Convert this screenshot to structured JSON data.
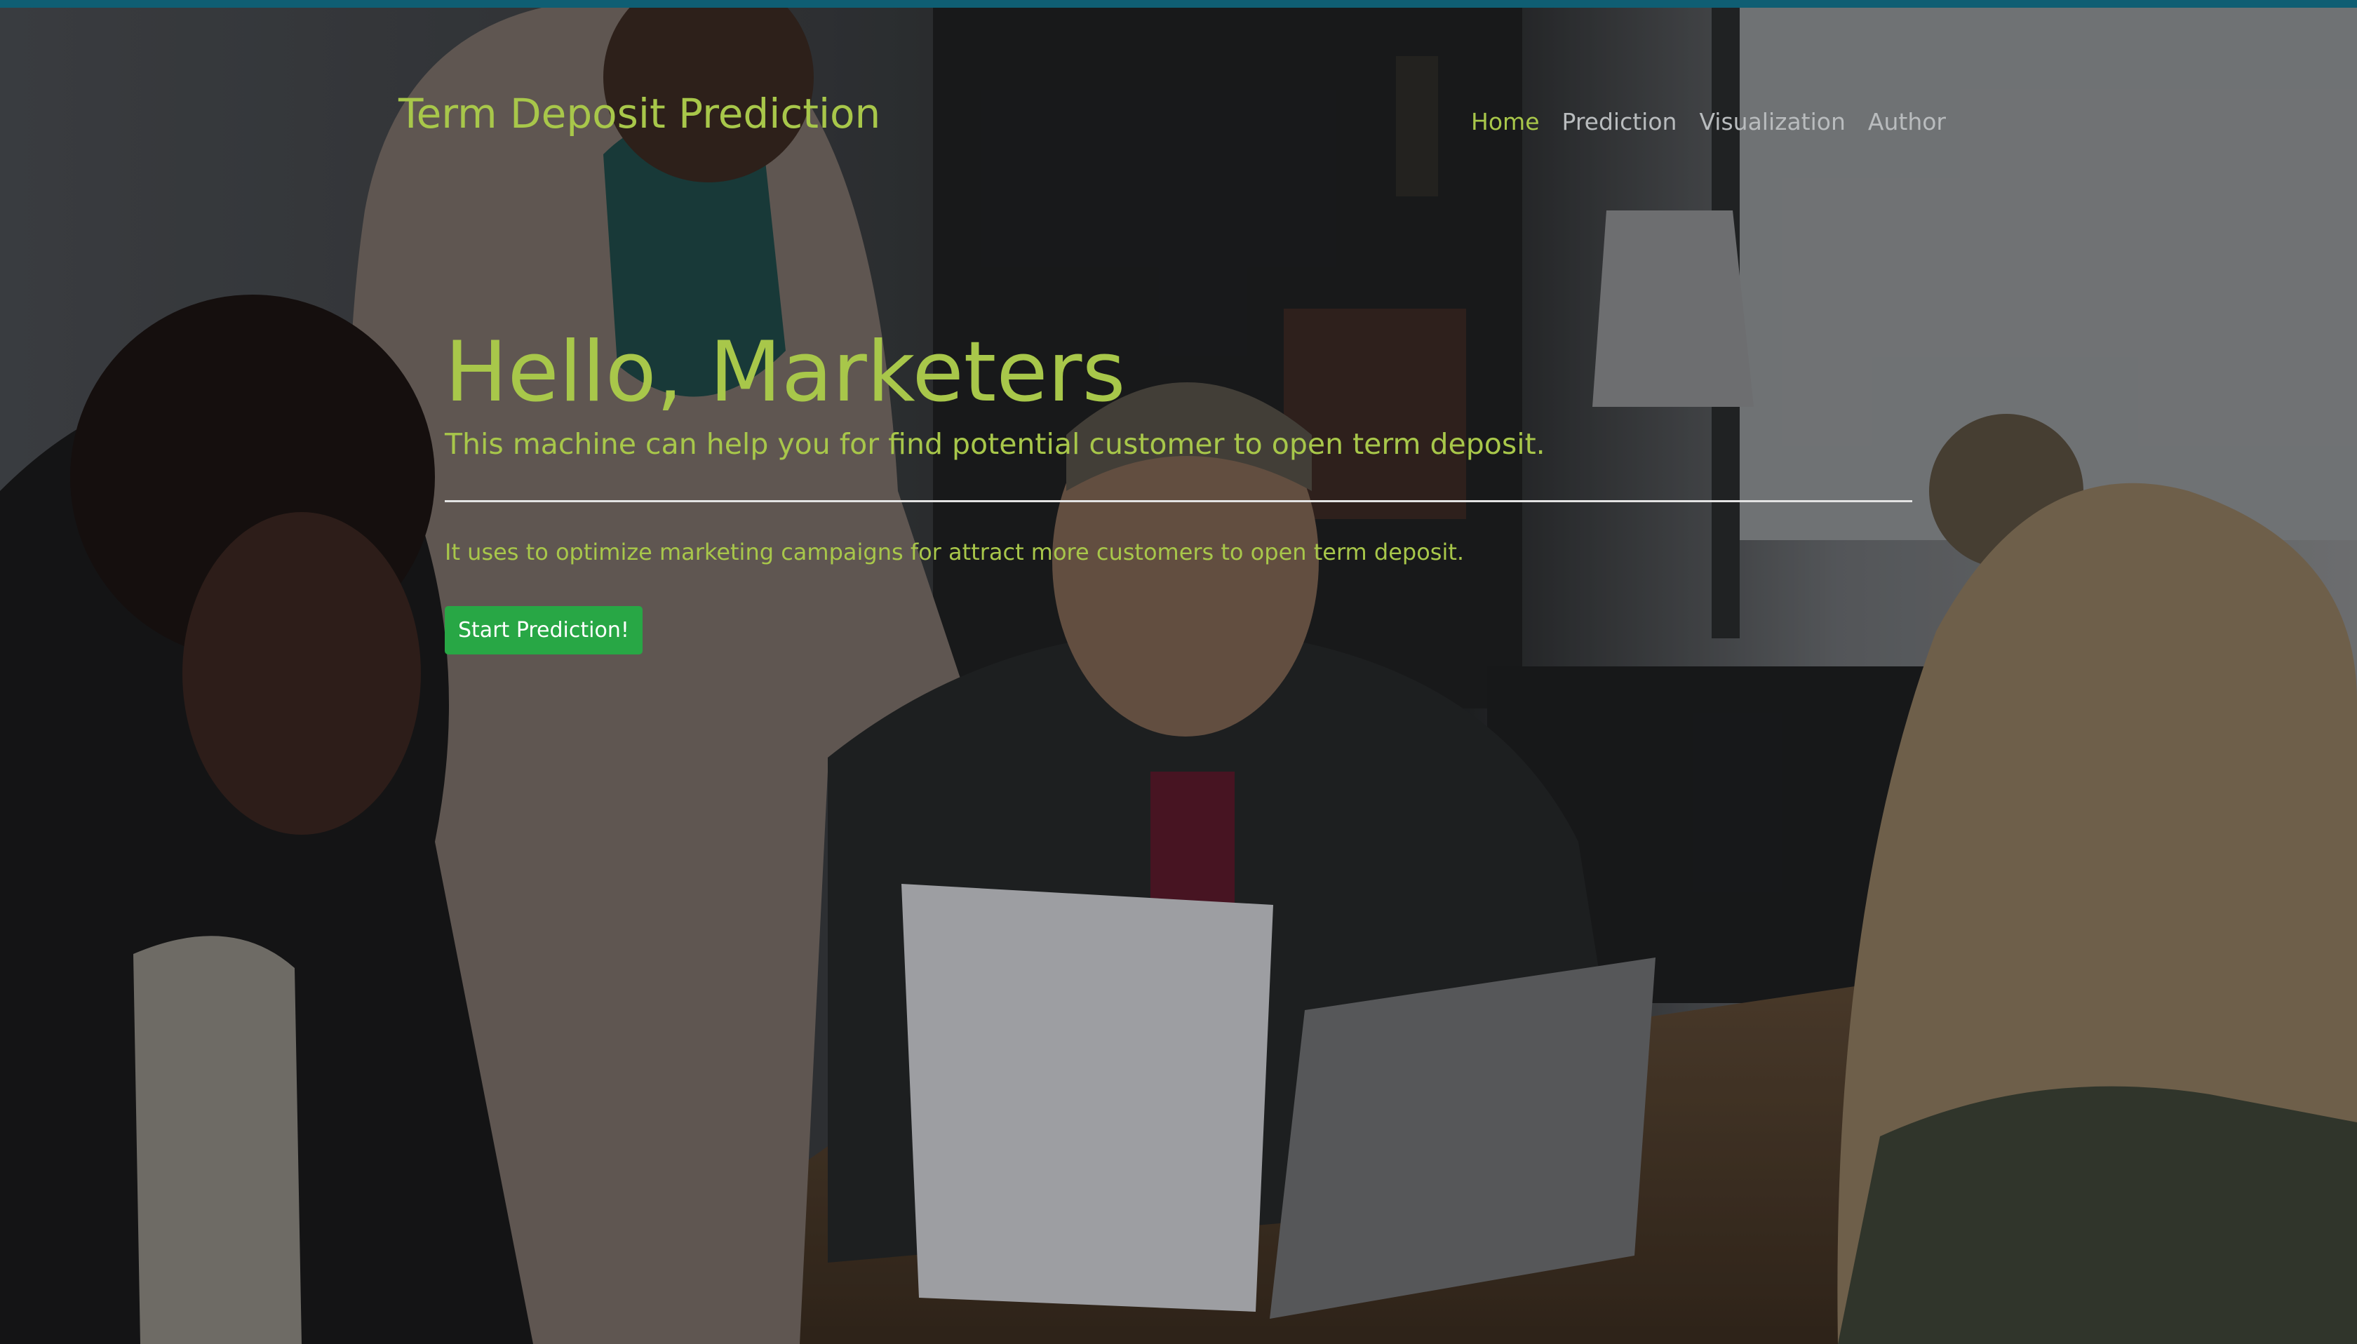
{
  "brand": {
    "title": "Term Deposit Prediction"
  },
  "nav": {
    "items": [
      {
        "label": "Home",
        "active": true
      },
      {
        "label": "Prediction",
        "active": false
      },
      {
        "label": "Visualization",
        "active": false
      },
      {
        "label": "Author",
        "active": false
      }
    ]
  },
  "hero": {
    "title": "Hello, Marketers",
    "lead": "This machine can help you for find potential customer to open term deposit.",
    "text": "It uses to optimize marketing campaigns for attract more customers to open term deposit.",
    "button_label": "Start Prediction!"
  },
  "colors": {
    "accent": "#a8c74a",
    "nav_inactive": "#b9bcbe",
    "button": "#28a745",
    "top_bar": "#0f5e73"
  },
  "background": {
    "image": "office-meeting-photo"
  }
}
